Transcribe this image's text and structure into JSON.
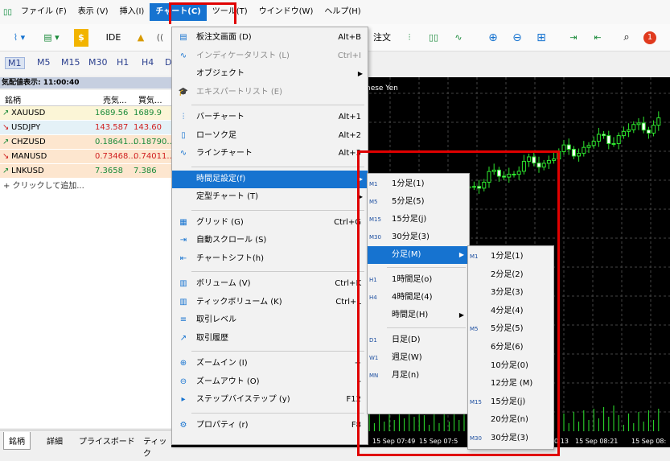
{
  "menubar": {
    "items": [
      "ファイル (F)",
      "表示 (V)",
      "挿入(I)",
      "チャート(C)",
      "ツール(T)",
      "ウインドウ(W)",
      "ヘルプ(H)"
    ],
    "active_index": 3
  },
  "toolbar": {
    "ide_label": "IDE",
    "order_label": "注文",
    "notification_count": "1"
  },
  "timeframes": [
    "M1",
    "M5",
    "M15",
    "M30",
    "H1",
    "H4",
    "D"
  ],
  "market_watch": {
    "title": "気配値表示: 11:00:40",
    "columns": [
      "銘柄",
      "売気...",
      "買気..."
    ],
    "rows": [
      {
        "symbol": "XAUUSD",
        "bid": "1689.56",
        "ask": "1689.9",
        "dir": "up",
        "bg": "#fbf5d6"
      },
      {
        "symbol": "USDJPY",
        "bid": "143.587",
        "ask": "143.60",
        "dir": "down",
        "bg": "#e4f1f7"
      },
      {
        "symbol": "CHZUSD",
        "bid": "0.18641...",
        "ask": "0.18790...",
        "dir": "up",
        "bg": "#fde6cf"
      },
      {
        "symbol": "MANUSD",
        "bid": "0.73468...",
        "ask": "0.74011...",
        "dir": "down",
        "bg": "#fde6cf"
      },
      {
        "symbol": "LNKUSD",
        "bid": "7.3658",
        "ask": "7.386",
        "dir": "up",
        "bg": "#fde6cf"
      }
    ],
    "add_label": "+ クリックして追加...",
    "tabs": [
      "銘柄",
      "詳細",
      "プライスボード",
      "ティック"
    ]
  },
  "chart": {
    "title_fragment": "nese Yen",
    "time_labels": [
      "15 Sep 07:49",
      "15 Sep 07:5",
      "0:13",
      "15 Sep 08:21",
      "15 Sep 08:"
    ]
  },
  "chart_menu": {
    "items": [
      {
        "label": "板注文画面 (D)",
        "shortcut": "Alt+B",
        "icon": "board-order-icon"
      },
      {
        "label": "インディケータリスト (L)",
        "shortcut": "Ctrl+I",
        "icon": "indicator-list-icon",
        "disabled": true
      },
      {
        "label": "オブジェクト",
        "submenu": true
      },
      {
        "label": "エキスパートリスト (E)",
        "icon": "expert-list-icon",
        "disabled": true
      },
      {
        "sep": true
      },
      {
        "label": "バーチャート",
        "shortcut": "Alt+1",
        "icon": "bar-chart-icon"
      },
      {
        "label": "ローソク足",
        "shortcut": "Alt+2",
        "icon": "candlestick-icon"
      },
      {
        "label": "ラインチャート",
        "shortcut": "Alt+3",
        "icon": "line-chart-icon"
      },
      {
        "sep": true
      },
      {
        "label": "時間足設定(f)",
        "submenu": true,
        "highlight": true
      },
      {
        "label": "定型チャート (T)",
        "submenu": true
      },
      {
        "sep": true
      },
      {
        "label": "グリッド (G)",
        "shortcut": "Ctrl+G",
        "icon": "grid-icon"
      },
      {
        "label": "自動スクロール (S)",
        "icon": "auto-scroll-icon"
      },
      {
        "label": "チャートシフト(h)",
        "icon": "chart-shift-icon"
      },
      {
        "sep": true
      },
      {
        "label": "ボリューム (V)",
        "shortcut": "Ctrl+K",
        "icon": "volume-icon"
      },
      {
        "label": "ティックボリューム (K)",
        "shortcut": "Ctrl+L",
        "icon": "tick-volume-icon"
      },
      {
        "label": "取引レベル",
        "icon": "trade-levels-icon"
      },
      {
        "label": "取引履歴",
        "icon": "trade-history-icon"
      },
      {
        "sep": true
      },
      {
        "label": "ズームイン (I)",
        "shortcut": "+",
        "icon": "zoom-in-icon"
      },
      {
        "label": "ズームアウト (O)",
        "shortcut": "-",
        "icon": "zoom-out-icon"
      },
      {
        "label": "ステップバイステップ (y)",
        "shortcut": "F12",
        "icon": "step-by-step-icon"
      },
      {
        "sep": true
      },
      {
        "label": "プロパティ (r)",
        "shortcut": "F8",
        "icon": "properties-icon"
      }
    ]
  },
  "tf_menu": {
    "items": [
      {
        "code": "M1",
        "label": "1分足(1)"
      },
      {
        "code": "M5",
        "label": "5分足(5)"
      },
      {
        "code": "M15",
        "label": "15分足(j)"
      },
      {
        "code": "M30",
        "label": "30分足(3)"
      },
      {
        "label": "分足(M)",
        "submenu": true,
        "highlight": true
      },
      {
        "sep": true
      },
      {
        "code": "H1",
        "label": "1時間足(o)"
      },
      {
        "code": "H4",
        "label": "4時間足(4)"
      },
      {
        "label": "時間足(H)",
        "submenu": true
      },
      {
        "sep": true
      },
      {
        "code": "D1",
        "label": "日足(D)"
      },
      {
        "code": "W1",
        "label": "週足(W)"
      },
      {
        "code": "MN",
        "label": "月足(n)"
      }
    ]
  },
  "min_menu": {
    "items": [
      {
        "code": "M1",
        "label": "1分足(1)"
      },
      {
        "label": "2分足(2)"
      },
      {
        "label": "3分足(3)"
      },
      {
        "label": "4分足(4)"
      },
      {
        "code": "M5",
        "label": "5分足(5)"
      },
      {
        "label": "6分足(6)"
      },
      {
        "label": "10分足(0)"
      },
      {
        "label": "12分足 (M)"
      },
      {
        "code": "M15",
        "label": "15分足(j)"
      },
      {
        "label": "20分足(n)"
      },
      {
        "code": "M30",
        "label": "30分足(3)"
      }
    ]
  }
}
